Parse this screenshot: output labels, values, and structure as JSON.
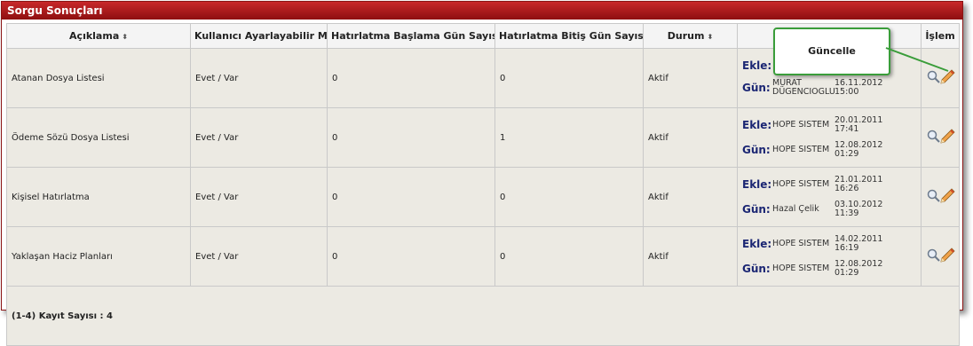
{
  "title": "Sorgu Sonuçları",
  "columns": [
    {
      "label": "Açıklama",
      "sort": "⬍"
    },
    {
      "label": "Kullanıcı Ayarlayabilir Mi",
      "sort": "⬍"
    },
    {
      "label": "Hatırlatma Başlama Gün Sayısı",
      "sort": "⬍"
    },
    {
      "label": "Hatırlatma Bitiş Gün Sayısı",
      "sort": "⬍"
    },
    {
      "label": "Durum",
      "sort": "⬍"
    },
    {
      "label": "",
      "sort": ""
    },
    {
      "label": "İşlem",
      "sort": ""
    }
  ],
  "labels": {
    "ekle": "Ekle:",
    "gun": "Gün:"
  },
  "rows": [
    {
      "aciklama": "Atanan Dosya Listesi",
      "ayarlanabilir": "Evet / Var",
      "baslama": "0",
      "bitis": "0",
      "durum": "Aktif",
      "ekle": {
        "name": "",
        "date": ""
      },
      "gun": {
        "name": "MURAT DÜGENCIOGLU",
        "date": "16.11.2012 15:00"
      }
    },
    {
      "aciklama": "Ödeme Sözü Dosya Listesi",
      "ayarlanabilir": "Evet / Var",
      "baslama": "0",
      "bitis": "1",
      "durum": "Aktif",
      "ekle": {
        "name": "HOPE SISTEM",
        "date": "20.01.2011 17:41"
      },
      "gun": {
        "name": "HOPE SISTEM",
        "date": "12.08.2012 01:29"
      }
    },
    {
      "aciklama": "Kişisel Hatırlatma",
      "ayarlanabilir": "Evet / Var",
      "baslama": "0",
      "bitis": "0",
      "durum": "Aktif",
      "ekle": {
        "name": "HOPE SISTEM",
        "date": "21.01.2011 16:26"
      },
      "gun": {
        "name": "Hazal Çelik",
        "date": "03.10.2012 11:39"
      }
    },
    {
      "aciklama": "Yaklaşan Haciz Planları",
      "ayarlanabilir": "Evet / Var",
      "baslama": "0",
      "bitis": "0",
      "durum": "Aktif",
      "ekle": {
        "name": "HOPE SISTEM",
        "date": "14.02.2011 16:19"
      },
      "gun": {
        "name": "HOPE SISTEM",
        "date": "12.08.2012 01:29"
      }
    }
  ],
  "footer": "(1-4) Kayıt Sayısı : 4",
  "callout": "Güncelle",
  "icons": {
    "view": "magnifier-icon",
    "edit": "pencil-icon"
  },
  "colors": {
    "title_bar": "#a51c1e",
    "callout_border": "#3a9d3a",
    "label": "#1b2673"
  }
}
